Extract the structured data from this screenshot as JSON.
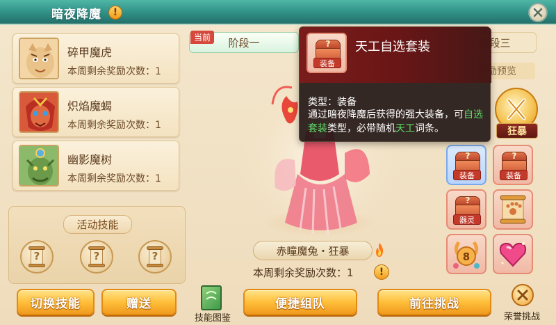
{
  "window": {
    "title": "暗夜降魔",
    "title_alert": "!"
  },
  "bosses": [
    {
      "name": "碎甲魔虎",
      "reward_text": "本周剩余奖励次数：1",
      "portrait_icon": "tiger-demon-portrait"
    },
    {
      "name": "炽焰魔蝎",
      "reward_text": "本周剩余奖励次数：1",
      "portrait_icon": "scorpion-demon-portrait"
    },
    {
      "name": "幽影魔树",
      "reward_text": "本周剩余奖励次数：1",
      "portrait_icon": "tree-demon-portrait"
    }
  ],
  "activity_skills": {
    "title": "活动技能",
    "slots": [
      {
        "icon": "unknown-scroll-icon",
        "symbol": "?"
      },
      {
        "icon": "unknown-scroll-icon",
        "symbol": "?"
      },
      {
        "icon": "unknown-scroll-icon",
        "symbol": "?"
      }
    ]
  },
  "stages": {
    "current_badge": "当前",
    "tabs": [
      {
        "label": "阶段一"
      },
      {
        "label": "阶段三"
      }
    ]
  },
  "character": {
    "name": "赤瞳魔兔・狂暴",
    "reward_text": "本周剩余奖励次数：1",
    "info_symbol": "!"
  },
  "rewards": {
    "header": "奖励预览",
    "badge_label": "狂暴",
    "items": [
      {
        "tag": "装备",
        "symbol": "?",
        "style": "blue"
      },
      {
        "tag": "装备",
        "symbol": "?",
        "style": "red"
      },
      {
        "tag": "器灵",
        "symbol": "?",
        "style": "red"
      },
      {
        "tag": "",
        "symbol": "",
        "style": "red",
        "icon": "paw-scroll-icon"
      },
      {
        "tag": "",
        "symbol": "",
        "style": "red",
        "icon": "orange-medal-icon"
      },
      {
        "tag": "",
        "symbol": "",
        "style": "red",
        "icon": "pink-heart-gem-icon"
      }
    ]
  },
  "tooltip": {
    "title": "天工自选套装",
    "icon_tag": "装备",
    "icon_symbol": "?",
    "type_line": "类型：装备",
    "desc_part1": "通过暗夜降魔后获得的强大装备，可",
    "desc_hl1": "自选套装",
    "desc_part2": "类型，必带随机",
    "desc_hl2": "天工",
    "desc_part3": "词条。"
  },
  "buttons": {
    "switch_skill": "切换技能",
    "gift": "赠送",
    "quick_team": "便捷组队",
    "go_challenge": "前往挑战"
  },
  "bottom_icons": {
    "skill_book": "技能图鉴",
    "honor_challenge": "荣誉挑战"
  },
  "colors": {
    "primary_button": "#ffbf3a",
    "header_teal": "#2f8f86",
    "highlight_green": "#5fe06a",
    "tooltip_bg": "#241816"
  }
}
